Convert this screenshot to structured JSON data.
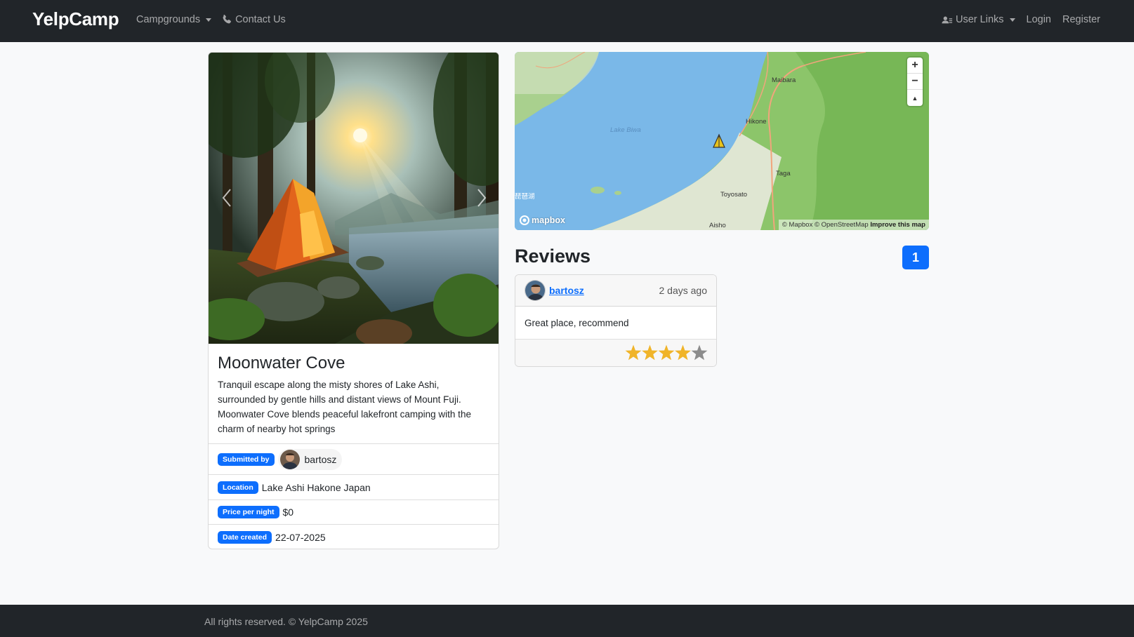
{
  "navbar": {
    "brand": "YelpCamp",
    "campgrounds_label": "Campgrounds",
    "contact_label": "Contact Us",
    "user_links_label": "User Links",
    "login_label": "Login",
    "register_label": "Register"
  },
  "campground": {
    "title": "Moonwater Cove",
    "description": "Tranquil escape along the misty shores of Lake Ashi, surrounded by gentle hills and distant views of Mount Fuji. Moonwater Cove blends peaceful lakefront camping with the charm of nearby hot springs",
    "submitted_by_label": "Submitted by",
    "author": "bartosz",
    "location_label": "Location",
    "location": "Lake Ashi Hakone Japan",
    "price_label": "Price per night",
    "price": "$0",
    "date_label": "Date created",
    "date": "22-07-2025"
  },
  "map": {
    "logo_text": "mapbox",
    "attribution_mapbox": "© Mapbox",
    "attribution_osm": "© OpenStreetMap",
    "attribution_improve": "Improve this map",
    "labels": {
      "lake": "Lake Biwa",
      "maibara": "Maibara",
      "hikone": "Hikone",
      "taga": "Taga",
      "toyosato": "Toyosato",
      "aisho": "Aisho",
      "kanji": "琵琶湖"
    },
    "zoom_in": "+",
    "zoom_out": "−",
    "compass": "▲"
  },
  "reviews": {
    "title": "Reviews",
    "count": "1",
    "items": [
      {
        "author": "bartosz",
        "date": "2 days ago",
        "body": "Great place, recommend",
        "rating": 4,
        "max_rating": 5
      }
    ]
  },
  "footer": {
    "text": "All rights reserved. © YelpCamp 2025"
  },
  "colors": {
    "primary": "#0d6efd",
    "navbar": "#212529",
    "star_on": "#f0b429",
    "star_off": "#8c8c8c"
  }
}
